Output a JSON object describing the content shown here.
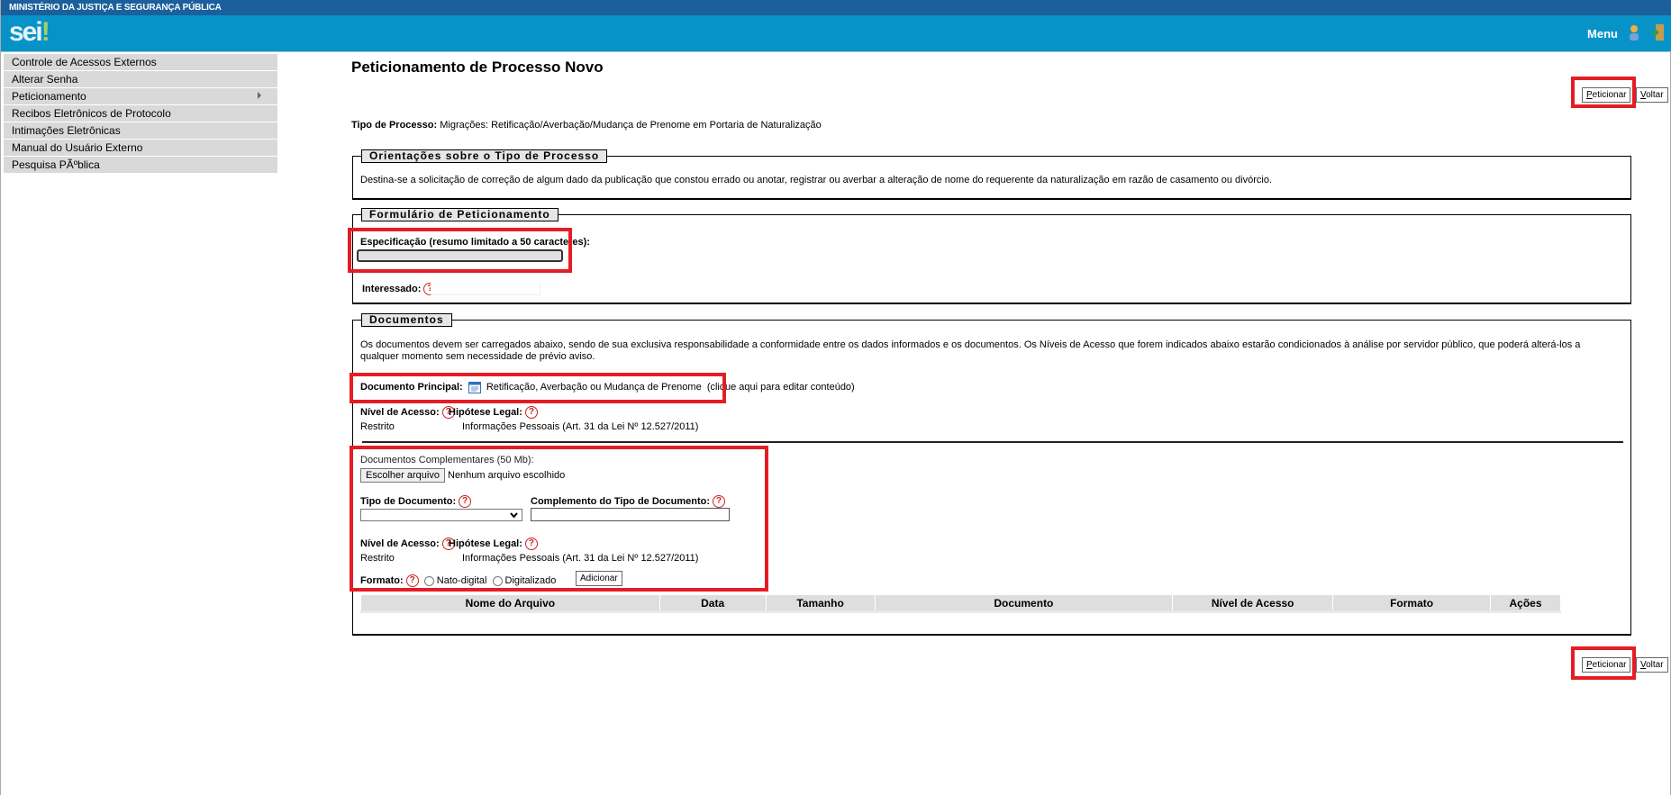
{
  "header": {
    "org": "MINISTÉRIO DA JUSTIÇA E SEGURANÇA PÚBLICA",
    "logo": "sei!",
    "menu_label": "Menu"
  },
  "sidebar": {
    "items": [
      {
        "label": "Controle de Acessos Externos"
      },
      {
        "label": "Alterar Senha"
      },
      {
        "label": "Peticionamento",
        "submenu": true
      },
      {
        "label": "Recibos Eletrônicos de Protocolo"
      },
      {
        "label": "Intimações Eletrônicas"
      },
      {
        "label": "Manual do Usuário Externo"
      },
      {
        "label": "Pesquisa PÃºblica"
      }
    ]
  },
  "page": {
    "title": "Peticionamento de Processo Novo",
    "peticionar_p": "P",
    "peticionar_rest": "eticionar",
    "voltar_v": "V",
    "voltar_rest": "oltar",
    "tipo_label": "Tipo de Processo:",
    "tipo_value": "Migrações: Retificação/Averbação/Mudança de Prenome em Portaria de Naturalização"
  },
  "orientacoes": {
    "legend": "Orientações sobre o Tipo de Processo",
    "text": "Destina-se a solicitação de correção de algum dado da publicação que constou errado ou anotar, registrar ou averbar a alteração de nome do requerente da naturalização em razão de casamento ou divórcio."
  },
  "formulario": {
    "legend": "Formulário de Peticionamento",
    "especificacao_label": "Especificação (resumo limitado a 50 caracteres):",
    "especificacao_value": "",
    "interessado_label": "Interessado:",
    "interessado_value": ""
  },
  "documentos": {
    "legend": "Documentos",
    "intro": "Os documentos devem ser carregados abaixo, sendo de sua exclusiva responsabilidade a conformidade entre os dados informados e os documentos. Os Níveis de Acesso que forem indicados abaixo estarão condicionados à análise por servidor público, que poderá alterá-los a qualquer momento sem necessidade de prévio aviso.",
    "principal_label": "Documento Principal:",
    "principal_name": "Retificação, Averbação ou Mudança de Prenome",
    "principal_edit": "(clique aqui para editar conteúdo)",
    "nivel_label": "Nível de Acesso:",
    "nivel_value": "Restrito",
    "hipotese_label": "Hipótese Legal:",
    "hipotese_value": "Informações Pessoais (Art. 31 da Lei Nº 12.527/2011)",
    "complementares_label": "Documentos Complementares (50 Mb):",
    "choose_file": "Escolher arquivo",
    "no_file": "Nenhum arquivo escolhido",
    "tipo_doc_label": "Tipo de Documento:",
    "tipo_doc_value": "",
    "complemento_label": "Complemento do Tipo de Documento:",
    "complemento_value": "",
    "nivel2_value": "Restrito",
    "hipotese2_value": "Informações Pessoais (Art. 31 da Lei Nº 12.527/2011)",
    "formato_label": "Formato:",
    "nato": "Nato-digital",
    "digitalizado": "Digitalizado",
    "adicionar": "Adicionar",
    "columns": [
      "Nome do Arquivo",
      "Data",
      "Tamanho",
      "Documento",
      "Nível de Acesso",
      "Formato",
      "Ações"
    ]
  },
  "colors": {
    "highlight": "#e41d25",
    "band": "#0893c8",
    "topbar": "#1b5f9c"
  }
}
